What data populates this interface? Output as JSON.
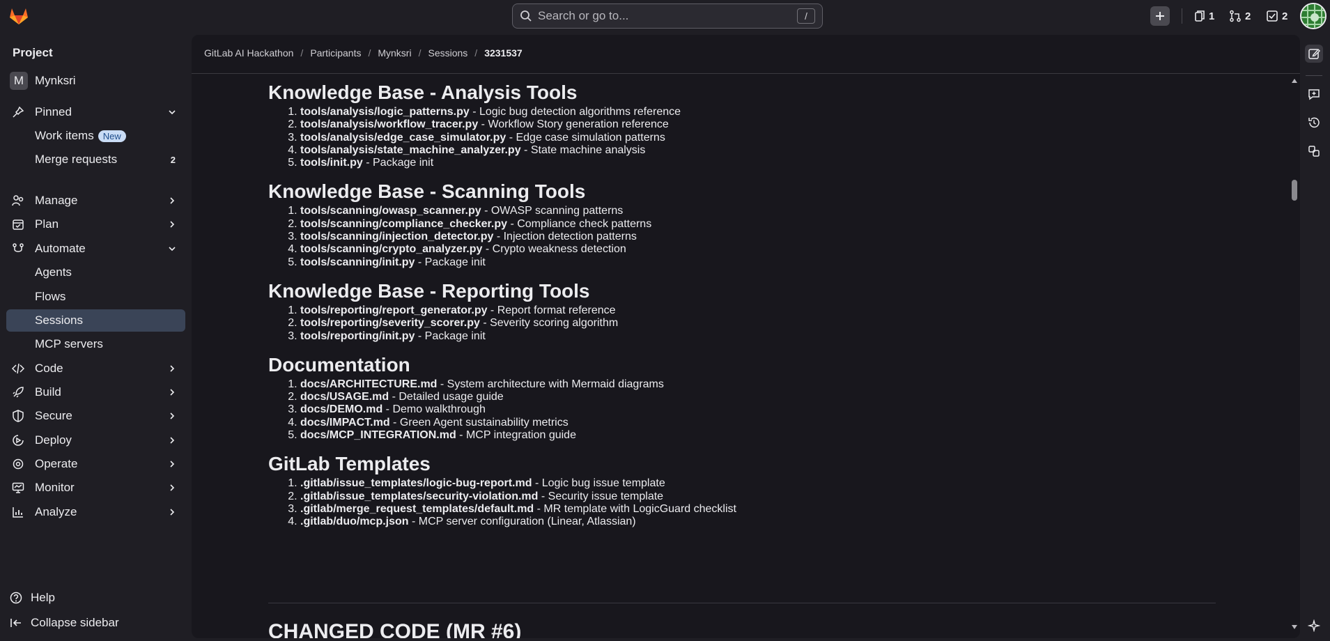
{
  "topbar": {
    "search_placeholder": "Search or go to...",
    "search_shortcut": "/",
    "issues_count": "1",
    "merge_requests_count": "2",
    "todos_count": "2"
  },
  "sidebar": {
    "section_title": "Project",
    "project_initial": "M",
    "project_name": "Mynksri",
    "pinned": "Pinned",
    "work_items": "Work items",
    "work_items_badge": "New",
    "merge_requests": "Merge requests",
    "merge_requests_count": "2",
    "manage": "Manage",
    "plan": "Plan",
    "automate": "Automate",
    "agents": "Agents",
    "flows": "Flows",
    "sessions": "Sessions",
    "mcp_servers": "MCP servers",
    "code": "Code",
    "build": "Build",
    "secure": "Secure",
    "deploy": "Deploy",
    "operate": "Operate",
    "monitor": "Monitor",
    "analyze": "Analyze",
    "help": "Help",
    "collapse": "Collapse sidebar"
  },
  "breadcrumb": [
    "GitLab AI Hackathon",
    "Participants",
    "Mynksri",
    "Sessions",
    "3231537"
  ],
  "sections": [
    {
      "heading": "Knowledge Base - Analysis Tools",
      "items": [
        {
          "file": "tools/analysis/logic_patterns.py",
          "desc": " - Logic bug detection algorithms reference"
        },
        {
          "file": "tools/analysis/workflow_tracer.py",
          "desc": " - Workflow Story generation reference"
        },
        {
          "file": "tools/analysis/edge_case_simulator.py",
          "desc": " - Edge case simulation patterns"
        },
        {
          "file": "tools/analysis/state_machine_analyzer.py",
          "desc": " - State machine analysis"
        },
        {
          "file": "tools/init.py",
          "desc": " - Package init"
        }
      ]
    },
    {
      "heading": "Knowledge Base - Scanning Tools",
      "items": [
        {
          "file": "tools/scanning/owasp_scanner.py",
          "desc": " - OWASP scanning patterns"
        },
        {
          "file": "tools/scanning/compliance_checker.py",
          "desc": " - Compliance check patterns"
        },
        {
          "file": "tools/scanning/injection_detector.py",
          "desc": " - Injection detection patterns"
        },
        {
          "file": "tools/scanning/crypto_analyzer.py",
          "desc": " - Crypto weakness detection"
        },
        {
          "file": "tools/scanning/init.py",
          "desc": " - Package init"
        }
      ]
    },
    {
      "heading": "Knowledge Base - Reporting Tools",
      "items": [
        {
          "file": "tools/reporting/report_generator.py",
          "desc": " - Report format reference"
        },
        {
          "file": "tools/reporting/severity_scorer.py",
          "desc": " - Severity scoring algorithm"
        },
        {
          "file": "tools/reporting/init.py",
          "desc": " - Package init"
        }
      ]
    },
    {
      "heading": "Documentation",
      "items": [
        {
          "file": "docs/ARCHITECTURE.md",
          "desc": " - System architecture with Mermaid diagrams"
        },
        {
          "file": "docs/USAGE.md",
          "desc": " - Detailed usage guide"
        },
        {
          "file": "docs/DEMO.md",
          "desc": " - Demo walkthrough"
        },
        {
          "file": "docs/IMPACT.md",
          "desc": " - Green Agent sustainability metrics"
        },
        {
          "file": "docs/MCP_INTEGRATION.md",
          "desc": " - MCP integration guide"
        }
      ]
    },
    {
      "heading": "GitLab Templates",
      "items": [
        {
          "file": ".gitlab/issue_templates/logic-bug-report.md",
          "desc": " - Logic bug issue template"
        },
        {
          "file": ".gitlab/issue_templates/security-violation.md",
          "desc": " - Security issue template"
        },
        {
          "file": ".gitlab/merge_request_templates/default.md",
          "desc": " - MR template with LogicGuard checklist"
        },
        {
          "file": ".gitlab/duo/mcp.json",
          "desc": " - MCP server configuration (Linear, Atlassian)"
        }
      ]
    }
  ],
  "next_heading": "CHANGED CODE (MR #6)"
}
